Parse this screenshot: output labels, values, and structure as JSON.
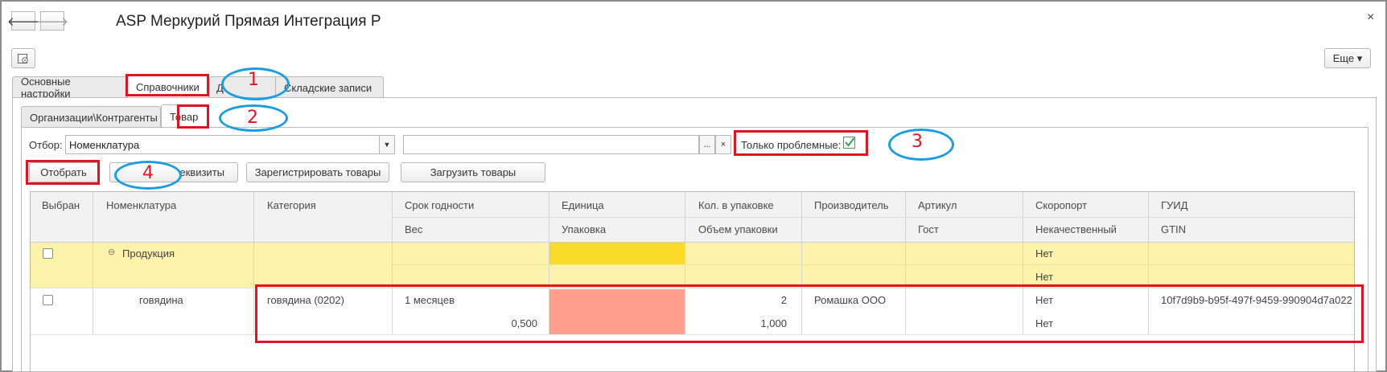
{
  "window": {
    "title": "ASP Меркурий Прямая Интеграция Р",
    "close_glyph": "×"
  },
  "nav": {
    "back_glyph": "🡐",
    "forward_glyph": "🡒"
  },
  "toolbar": {
    "more_label": "Еще ▾"
  },
  "tabs": [
    {
      "label": "Основные настройки"
    },
    {
      "label": "Справочники"
    },
    {
      "label": "Д"
    },
    {
      "label": "Складские записи"
    }
  ],
  "subtabs": [
    {
      "label": "Организации\\Контрагенты"
    },
    {
      "label": "Товар"
    }
  ],
  "filter": {
    "label": "Отбор:",
    "value": "Номенклатура",
    "second_value": "",
    "ellipsis_label": "...",
    "clear_label": "×",
    "only_problem_label": "Только проблемные:",
    "only_problem_checked": true
  },
  "buttons": {
    "select": "Отобрать",
    "requisites": "еквизиты",
    "register": "Зарегистрировать товары",
    "load": "Загрузить товары"
  },
  "annotations": [
    "1",
    "2",
    "3",
    "4"
  ],
  "table": {
    "headers_top": [
      "Выбран",
      "Номенклатура",
      "Категория",
      "Срок годности",
      "Единица",
      "Кол. в упаковке",
      "Производитель",
      "Артикул",
      "Скоропорт",
      "ГУИД"
    ],
    "headers_bottom": [
      "Вес",
      "Упаковка",
      "Объем упаковки",
      "Гост",
      "Некачественный",
      "GTIN"
    ],
    "group_row": {
      "expander": "⊖",
      "name": "Продукция",
      "skoroport": "Нет",
      "nekach": "Нет"
    },
    "item_row": {
      "name": "говядина",
      "category": "говядина (0202)",
      "shelf_life": "1 месяцев",
      "weight": "0,500",
      "qty_pack": "2",
      "volume": "1,000",
      "producer": "Ромашка ООО",
      "skoroport": "Нет",
      "nekach": "Нет",
      "guid": "10f7d9b9-b95f-497f-9459-990904d7a022"
    }
  },
  "colors": {
    "highlight_red": "#e3141f",
    "annotation_blue": "#1a9ee0",
    "group_row_bg": "#fcf2a9",
    "unit_yellow": "#fadb27",
    "unit_salmon": "#fca08c"
  }
}
